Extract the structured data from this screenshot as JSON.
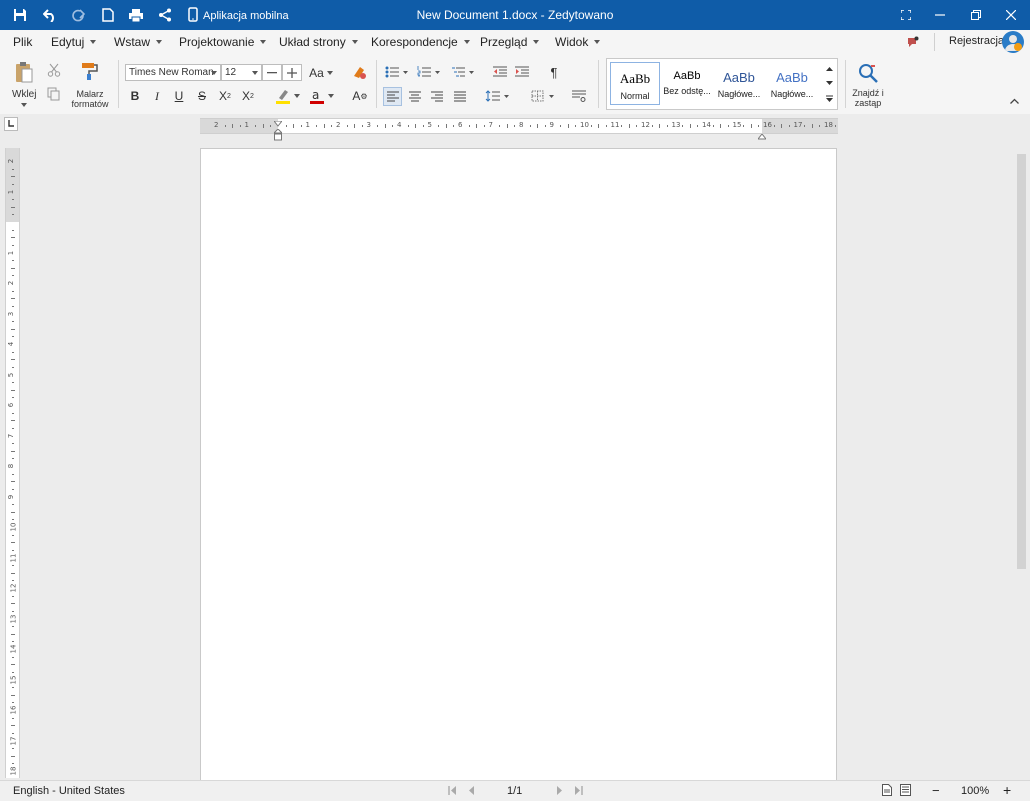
{
  "titlebar": {
    "title": "New Document 1.docx - Zedytowano",
    "mobile_app_label": "Aplikacja mobilna",
    "icons": [
      "save-icon",
      "undo-icon",
      "redo-icon",
      "new-document-icon",
      "print-icon",
      "share-icon",
      "mobile-phone-icon"
    ],
    "window_controls": [
      "fullscreen-icon",
      "minimize-icon",
      "restore-icon",
      "close-icon"
    ],
    "color": "#0f5ca8"
  },
  "menubar": {
    "items": [
      {
        "label": "Plik",
        "has_dropdown": false
      },
      {
        "label": "Edytuj",
        "has_dropdown": true
      },
      {
        "label": "Wstaw",
        "has_dropdown": true
      },
      {
        "label": "Projektowanie",
        "has_dropdown": true
      },
      {
        "label": "Układ strony",
        "has_dropdown": true
      },
      {
        "label": "Korespondencje",
        "has_dropdown": true
      },
      {
        "label": "Przegląd",
        "has_dropdown": true
      },
      {
        "label": "Widok",
        "has_dropdown": true
      }
    ],
    "register_label": "Rejestracja"
  },
  "ribbon": {
    "paste_label": "Wklej",
    "format_painter_label_1": "Malarz",
    "format_painter_label_2": "formatów",
    "font_name": "Times New Roman",
    "font_size": "12",
    "change_case_label": "Aa",
    "find_replace_label_1": "Znajdź i",
    "find_replace_label_2": "zastąp",
    "styles": [
      {
        "sample": "AaBb",
        "name": "Normal",
        "selected": true
      },
      {
        "sample": "AaBb",
        "name": "Bez odstę...",
        "selected": false
      },
      {
        "sample": "AaBb",
        "name": "Nagłówe...",
        "selected": false
      },
      {
        "sample": "AaBb",
        "name": "Nagłówe...",
        "selected": false
      }
    ],
    "highlight_color": "#ffe000",
    "font_color": "#d00000"
  },
  "ruler": {
    "numbers": [
      "2",
      "1",
      "1",
      "2",
      "3",
      "4",
      "5",
      "6",
      "7",
      "8",
      "9",
      "10",
      "11",
      "12",
      "13",
      "14",
      "15",
      "16",
      "17",
      "18"
    ],
    "vertical_numbers": [
      "2",
      "1",
      "1",
      "2",
      "3",
      "4",
      "5",
      "6",
      "7",
      "8",
      "9",
      "10",
      "11",
      "12",
      "13",
      "14",
      "15",
      "16",
      "17",
      "18"
    ]
  },
  "statusbar": {
    "language": "English - United States",
    "page_indicator": "1/1",
    "zoom": "100%",
    "zoom_minus": "−",
    "zoom_plus": "+"
  }
}
